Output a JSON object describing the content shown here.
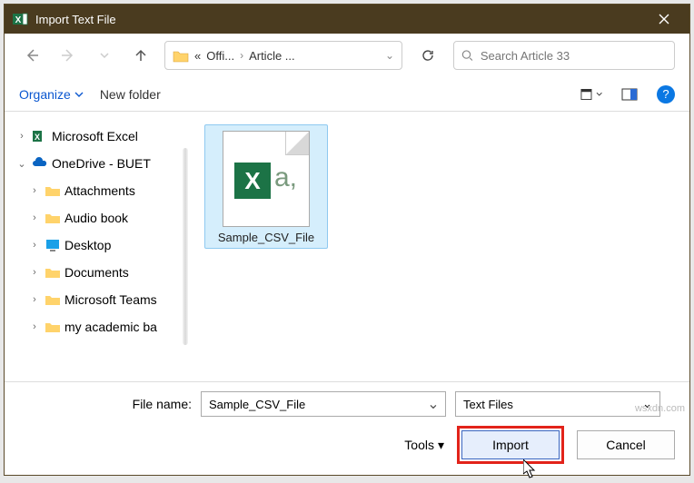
{
  "window": {
    "title": "Import Text File"
  },
  "nav": {
    "crumb_prefix": "«",
    "crumb1": "Offi...",
    "crumb2": "Article ..."
  },
  "search": {
    "placeholder": "Search Article 33"
  },
  "toolbar": {
    "organize": "Organize",
    "new_folder": "New folder"
  },
  "tree": {
    "item_excel": "Microsoft Excel",
    "item_onedrive": "OneDrive - BUET",
    "item_attachments": "Attachments",
    "item_audio": "Audio book",
    "item_desktop": "Desktop",
    "item_documents": "Documents",
    "item_msteams": "Microsoft Teams",
    "item_academic": "my academic ba"
  },
  "files": {
    "selected_name": "Sample_CSV_File"
  },
  "footer": {
    "file_name_label": "File name:",
    "file_name_value": "Sample_CSV_File",
    "file_type": "Text Files",
    "tools": "Tools",
    "import": "Import",
    "cancel": "Cancel"
  },
  "watermark": "wsxdn.com"
}
